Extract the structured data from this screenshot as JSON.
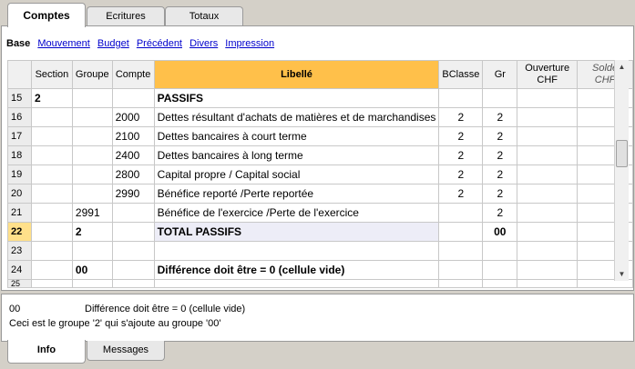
{
  "top_tabs": [
    "Comptes",
    "Ecritures",
    "Totaux"
  ],
  "links": {
    "current": "Base",
    "items": [
      "Mouvement",
      "Budget",
      "Précédent",
      "Divers",
      "Impression"
    ]
  },
  "table": {
    "headers": {
      "section": "Section",
      "groupe": "Groupe",
      "compte": "Compte",
      "libelle": "Libellé",
      "bclasse": "BClasse",
      "gr": "Gr",
      "ouverture": "Ouverture",
      "ouverture_unit": "CHF",
      "solde": "Solde",
      "solde_unit": "CHF"
    },
    "rows": [
      {
        "n": "15",
        "section": "2",
        "groupe": "",
        "compte": "",
        "libelle": "PASSIFS",
        "bclasse": "",
        "gr": ""
      },
      {
        "n": "16",
        "section": "",
        "groupe": "",
        "compte": "2000",
        "libelle": "Dettes résultant d'achats de matières et de marchandises",
        "bclasse": "2",
        "gr": "2"
      },
      {
        "n": "17",
        "section": "",
        "groupe": "",
        "compte": "2100",
        "libelle": "Dettes bancaires à court terme",
        "bclasse": "2",
        "gr": "2"
      },
      {
        "n": "18",
        "section": "",
        "groupe": "",
        "compte": "2400",
        "libelle": "Dettes bancaires à long terme",
        "bclasse": "2",
        "gr": "2"
      },
      {
        "n": "19",
        "section": "",
        "groupe": "",
        "compte": "2800",
        "libelle": "Capital propre / Capital social",
        "bclasse": "2",
        "gr": "2"
      },
      {
        "n": "20",
        "section": "",
        "groupe": "",
        "compte": "2990",
        "libelle": "Bénéfice reporté /Perte reportée",
        "bclasse": "2",
        "gr": "2"
      },
      {
        "n": "21",
        "section": "",
        "groupe": "2991",
        "compte": "",
        "libelle": "Bénéfice de l'exercice /Perte de l'exercice",
        "bclasse": "",
        "gr": "2"
      },
      {
        "n": "22",
        "section": "",
        "groupe": "2",
        "compte": "",
        "libelle": "TOTAL  PASSIFS",
        "bclasse": "",
        "gr": "00"
      },
      {
        "n": "23",
        "section": "",
        "groupe": "",
        "compte": "",
        "libelle": "",
        "bclasse": "",
        "gr": ""
      },
      {
        "n": "24",
        "section": "",
        "groupe": "00",
        "compte": "",
        "libelle": "Différence doit être = 0 (cellule vide)",
        "bclasse": "",
        "gr": ""
      }
    ],
    "partial_row_number": "25"
  },
  "info": {
    "line1_code": "00",
    "line1_text": "Différence doit être = 0 (cellule vide)",
    "line2": "Ceci est le groupe '2' qui s'ajoute au groupe '00'"
  },
  "bottom_tabs": [
    "Info",
    "Messages"
  ]
}
